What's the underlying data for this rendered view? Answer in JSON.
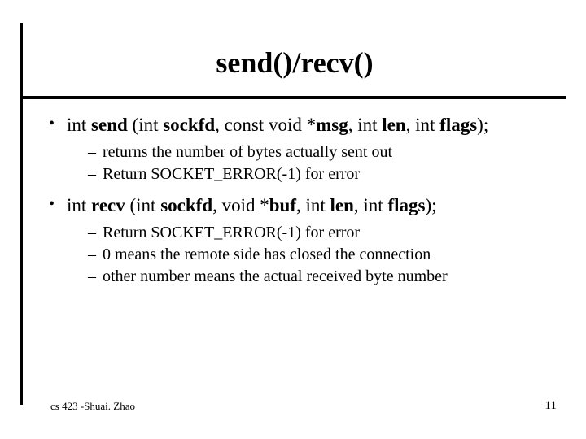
{
  "title": "send()/recv()",
  "bullets": {
    "b1_pre": "int ",
    "b1_send": "send",
    "b1_mid1": " (int ",
    "b1_sockfd": "sockfd",
    "b1_mid2": ", const void *",
    "b1_msg": "msg",
    "b1_mid3": ", int ",
    "b1_len": "len",
    "b1_mid4": ", int ",
    "b1_flags": "flags",
    "b1_post": ");",
    "b1_sub1": "returns the number of bytes actually sent out",
    "b1_sub2": "Return SOCKET_ERROR(-1) for error",
    "b2_pre": "int ",
    "b2_recv": "recv",
    "b2_mid1": " (int ",
    "b2_sockfd": "sockfd",
    "b2_mid2": ", void *",
    "b2_buf": "buf",
    "b2_mid3": ", int ",
    "b2_len": "len",
    "b2_mid4": ", int ",
    "b2_flags": "flags",
    "b2_post": ");",
    "b2_sub1": "Return SOCKET_ERROR(-1) for error",
    "b2_sub2": "0 means the remote side has closed the connection",
    "b2_sub3": "other number means the actual received byte number"
  },
  "footer": {
    "left": "cs 423 -Shuai. Zhao",
    "right": "11"
  }
}
